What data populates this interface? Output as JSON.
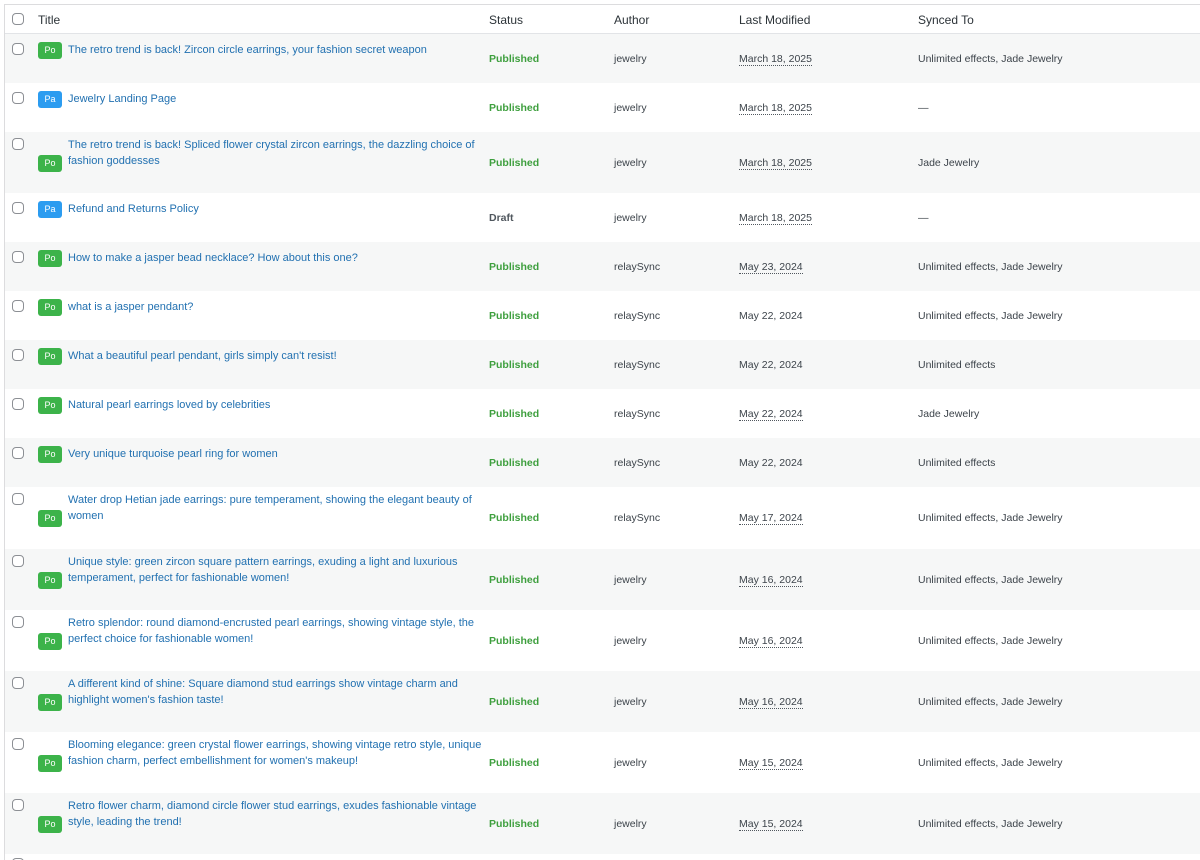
{
  "table": {
    "columns": {
      "title": "Title",
      "status": "Status",
      "author": "Author",
      "last_modified": "Last Modified",
      "synced_to": "Synced To"
    },
    "type_badges": {
      "post": "Po",
      "page": "Pa"
    },
    "rows": [
      {
        "type": "post",
        "title": "The retro trend is back! Zircon circle earrings, your fashion secret weapon",
        "status": "Published",
        "author": "jewelry",
        "modified": "March 18, 2025",
        "synced": "Unlimited effects, Jade Jewelry"
      },
      {
        "type": "page",
        "title": "Jewelry Landing Page",
        "status": "Published",
        "author": "jewelry",
        "modified": "March 18, 2025",
        "synced": "—"
      },
      {
        "type": "post",
        "title": "The retro trend is back! Spliced flower crystal zircon earrings, the dazzling choice of fashion goddesses",
        "status": "Published",
        "author": "jewelry",
        "modified": "March 18, 2025",
        "synced": "Jade Jewelry"
      },
      {
        "type": "page",
        "title": "Refund and Returns Policy",
        "status": "Draft",
        "author": "jewelry",
        "modified": "March 18, 2025",
        "synced": "—"
      },
      {
        "type": "post",
        "title": "How to make a jasper bead necklace? How about this one?",
        "status": "Published",
        "author": "relaySync",
        "modified": "May 23, 2024",
        "synced": "Unlimited effects, Jade Jewelry"
      },
      {
        "type": "post",
        "title": "what is a jasper pendant?",
        "status": "Published",
        "author": "relaySync",
        "modified": "May 22, 2024",
        "synced": "Unlimited effects, Jade Jewelry"
      },
      {
        "type": "post",
        "title": "What a beautiful pearl pendant, girls simply can't resist!",
        "status": "Published",
        "author": "relaySync",
        "modified": "May 22, 2024",
        "synced": "Unlimited effects"
      },
      {
        "type": "post",
        "title": "Natural pearl earrings loved by celebrities",
        "status": "Published",
        "author": "relaySync",
        "modified": "May 22, 2024",
        "synced": "Jade Jewelry"
      },
      {
        "type": "post",
        "title": "Very unique turquoise pearl ring for women",
        "status": "Published",
        "author": "relaySync",
        "modified": "May 22, 2024",
        "synced": "Unlimited effects"
      },
      {
        "type": "post",
        "title": "Water drop Hetian jade earrings: pure temperament, showing the elegant beauty of women",
        "status": "Published",
        "author": "relaySync",
        "modified": "May 17, 2024",
        "synced": "Unlimited effects, Jade Jewelry"
      },
      {
        "type": "post",
        "title": "Unique style: green zircon square pattern earrings, exuding a light and luxurious temperament, perfect for fashionable women!",
        "status": "Published",
        "author": "jewelry",
        "modified": "May 16, 2024",
        "synced": "Unlimited effects, Jade Jewelry"
      },
      {
        "type": "post",
        "title": "Retro splendor: round diamond-encrusted pearl earrings, showing vintage style, the perfect choice for fashionable women!",
        "status": "Published",
        "author": "jewelry",
        "modified": "May 16, 2024",
        "synced": "Unlimited effects, Jade Jewelry"
      },
      {
        "type": "post",
        "title": "A different kind of shine: Square diamond stud earrings show vintage charm and highlight women's fashion taste!",
        "status": "Published",
        "author": "jewelry",
        "modified": "May 16, 2024",
        "synced": "Unlimited effects, Jade Jewelry"
      },
      {
        "type": "post",
        "title": "Blooming elegance: green crystal flower earrings, showing vintage retro style, unique fashion charm, perfect embellishment for women's makeup!",
        "status": "Published",
        "author": "jewelry",
        "modified": "May 15, 2024",
        "synced": "Unlimited effects, Jade Jewelry"
      },
      {
        "type": "post",
        "title": "Retro flower charm, diamond circle flower stud earrings, exudes fashionable vintage style, leading the trend!",
        "status": "Published",
        "author": "jewelry",
        "modified": "May 15, 2024",
        "synced": "Unlimited effects, Jade Jewelry"
      }
    ]
  }
}
